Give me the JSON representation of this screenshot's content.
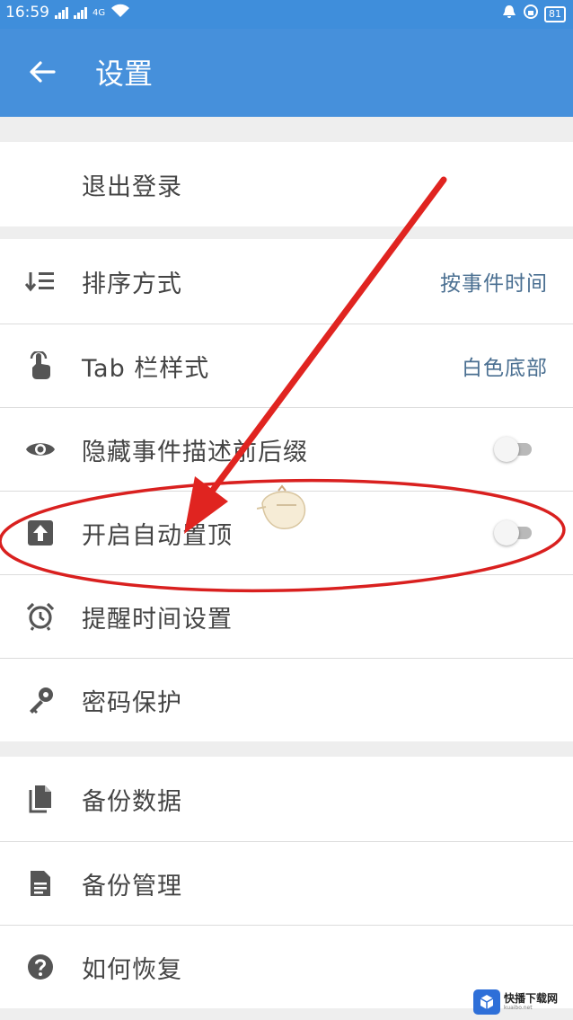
{
  "status_bar": {
    "time": "16:59",
    "network_label": "4G",
    "battery": "81",
    "icons": [
      "signal-icon",
      "wifi-icon",
      "alarm-icon",
      "lock-rotation-icon",
      "battery-icon"
    ]
  },
  "appbar": {
    "title": "设置",
    "back_icon": "arrow-back-icon",
    "color": "#4690db"
  },
  "group1": {
    "items": [
      {
        "label": "退出登录"
      }
    ]
  },
  "group2": {
    "items": [
      {
        "label": "排序方式",
        "value": "按事件时间",
        "icon": "sort-icon"
      },
      {
        "label": "Tab 栏样式",
        "value": "白色底部",
        "icon": "touch-icon"
      },
      {
        "label": "隐藏事件描述前后缀",
        "icon": "eye-icon",
        "toggle": false
      },
      {
        "label": "开启自动置顶",
        "icon": "upload-icon",
        "toggle": false
      },
      {
        "label": "提醒时间设置",
        "icon": "alarm-clock-icon"
      },
      {
        "label": "密码保护",
        "icon": "key-icon"
      }
    ]
  },
  "group3": {
    "items": [
      {
        "label": "备份数据",
        "icon": "copy-icon"
      },
      {
        "label": "备份管理",
        "icon": "document-icon"
      },
      {
        "label": "如何恢复",
        "icon": "help-icon"
      }
    ]
  },
  "watermark": {
    "name": "快播下载网",
    "url": "kuaibo.net"
  },
  "colors": {
    "accent": "#4690db",
    "value_text": "#4a6f91",
    "annotation": "#d9201f"
  }
}
